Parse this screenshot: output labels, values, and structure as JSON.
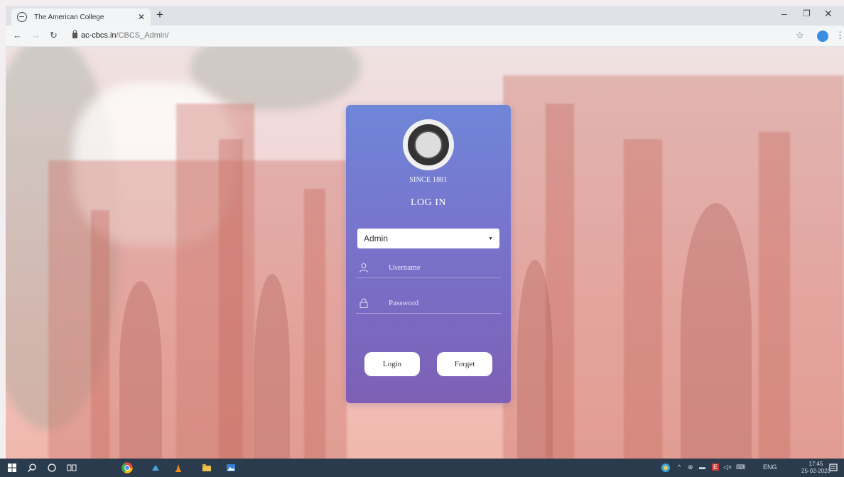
{
  "browser": {
    "tab_title": "The American College",
    "url_host": "ac-cbcs.in",
    "url_path": "/CBCS_Admin/"
  },
  "login": {
    "since": "SINCE 1881",
    "heading": "LOG IN",
    "role_selected": "Admin",
    "username_placeholder": "Username",
    "password_placeholder": "Password",
    "login_label": "Login",
    "forget_label": "Forget"
  },
  "taskbar": {
    "lang": "ENG",
    "time": "17:45",
    "date": "25-02-2020"
  },
  "colors": {
    "card_top": "#6f86d8",
    "card_bottom": "#7d5fb5",
    "taskbar": "#2a3b4e"
  }
}
